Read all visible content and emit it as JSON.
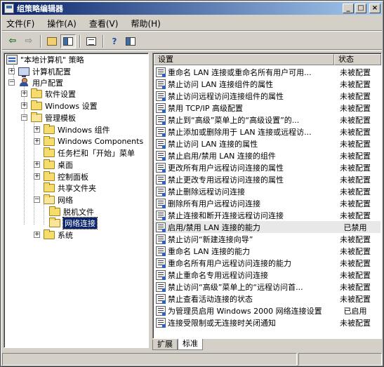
{
  "window": {
    "title": "组策略编辑器"
  },
  "menu": [
    "文件(F)",
    "操作(A)",
    "查看(V)",
    "帮助(H)"
  ],
  "toolbar": {
    "back_icon": "arrow-left-icon",
    "forward_icon": "arrow-right-icon",
    "up_icon": "folder-up-icon",
    "tree_icon": "show-tree-icon",
    "export_icon": "export-list-icon",
    "properties_icon": "properties-icon",
    "help_icon": "help-icon"
  },
  "tree": {
    "root": "\"本地计算机\" 策略",
    "computer_config": "计算机配置",
    "user_config": "用户配置",
    "software_settings": "软件设置",
    "windows_settings": "Windows 设置",
    "admin_templates": "管理模板",
    "windows_components": "Windows 组件",
    "windows_components2": "Windows Components",
    "taskbar": "任务栏和「开始」菜单",
    "desktop": "桌面",
    "control_panel": "控制面板",
    "shared_folders": "共享文件夹",
    "network": "网络",
    "offline_files": "脱机文件",
    "network_connections": "网络连接",
    "system": "系统"
  },
  "list": {
    "col_setting": "设置",
    "col_state": "状态",
    "rows": [
      {
        "name": "重命名 LAN 连接或重命名所有用户可用...",
        "state": "未被配置"
      },
      {
        "name": "禁止访问 LAN 连接组件的属性",
        "state": "未被配置"
      },
      {
        "name": "禁止访问远程访问连接组件的属性",
        "state": "未被配置"
      },
      {
        "name": "禁用 TCP/IP 高级配置",
        "state": "未被配置"
      },
      {
        "name": "禁止到“高级”菜单上的“高级设置”的...",
        "state": "未被配置"
      },
      {
        "name": "禁止添加或删除用于 LAN 连接或远程访...",
        "state": "未被配置"
      },
      {
        "name": "禁止访问 LAN 连接的属性",
        "state": "未被配置"
      },
      {
        "name": "禁止启用/禁用 LAN 连接的组件",
        "state": "未被配置"
      },
      {
        "name": "更改所有用户远程访问连接的属性",
        "state": "未被配置"
      },
      {
        "name": "禁止更改专用远程访问连接的属性",
        "state": "未被配置"
      },
      {
        "name": "禁止删除远程访问连接",
        "state": "未被配置"
      },
      {
        "name": "删除所有用户远程访问连接",
        "state": "未被配置"
      },
      {
        "name": "禁止连接和断开连接远程访问连接",
        "state": "未被配置"
      },
      {
        "name": "启用/禁用 LAN 连接的能力",
        "state": "已禁用"
      },
      {
        "name": "禁止访问“新建连接向导”",
        "state": "未被配置"
      },
      {
        "name": "重命名 LAN 连接的能力",
        "state": "未被配置"
      },
      {
        "name": "重命名所有用户远程访问连接的能力",
        "state": "未被配置"
      },
      {
        "name": "禁止重命名专用远程访问连接",
        "state": "未被配置"
      },
      {
        "name": "禁止访问“高级”菜单上的“远程访问首...",
        "state": "未被配置"
      },
      {
        "name": "禁止查看活动连接的状态",
        "state": "未被配置"
      },
      {
        "name": "为管理员启用 Windows 2000 网络连接设置",
        "state": "已启用"
      },
      {
        "name": "连接受限制或无连接时关闭通知",
        "state": "未被配置"
      }
    ]
  },
  "tabs": [
    "扩展",
    "标准"
  ]
}
